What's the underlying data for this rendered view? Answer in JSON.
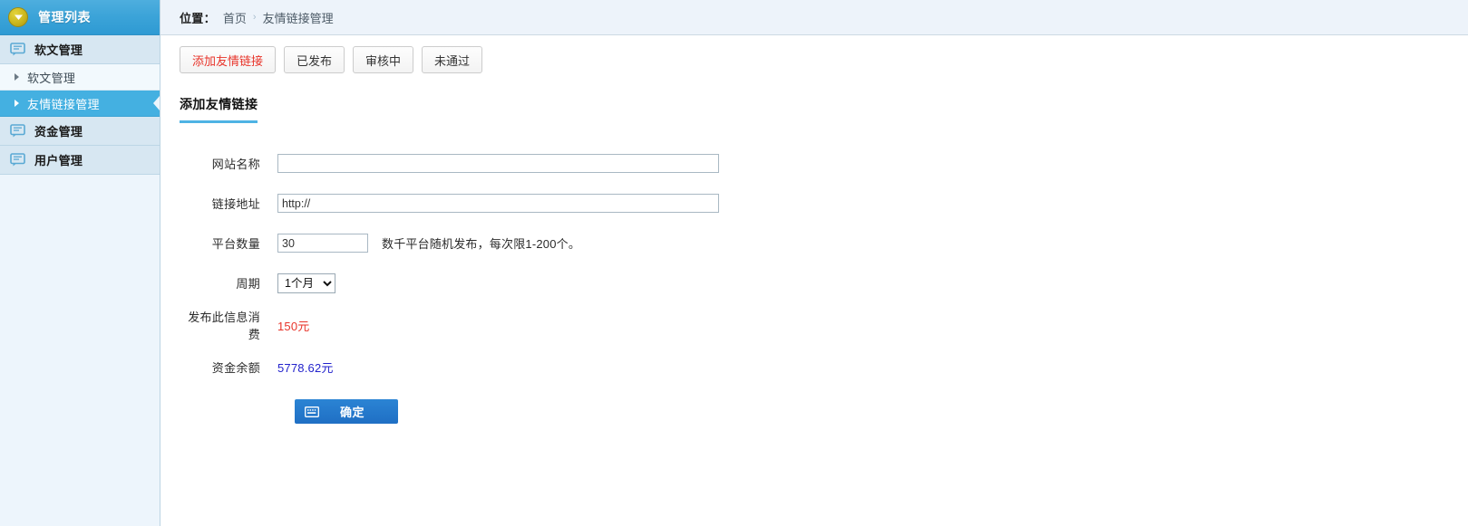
{
  "sidebar": {
    "header": {
      "title": "管理列表",
      "icon": "chevron-down-circle-icon"
    },
    "sections": [
      {
        "label": "软文管理",
        "icon": "speech-bubble-icon",
        "subitems": [
          {
            "label": "软文管理",
            "active": false
          },
          {
            "label": "友情链接管理",
            "active": true
          }
        ]
      },
      {
        "label": "资金管理",
        "icon": "speech-bubble-icon",
        "subitems": []
      },
      {
        "label": "用户管理",
        "icon": "speech-bubble-icon",
        "subitems": []
      }
    ]
  },
  "breadcrumb": {
    "label": "位置：",
    "home": "首页",
    "separator": "›",
    "current": "友情链接管理"
  },
  "tabs": [
    {
      "label": "添加友情链接",
      "active": true
    },
    {
      "label": "已发布",
      "active": false
    },
    {
      "label": "审核中",
      "active": false
    },
    {
      "label": "未通过",
      "active": false
    }
  ],
  "panel": {
    "title": "添加友情链接",
    "form": {
      "site_name": {
        "label": "网站名称",
        "value": "",
        "placeholder": ""
      },
      "link_url": {
        "label": "链接地址",
        "value": "http://"
      },
      "platform_count": {
        "label": "平台数量",
        "value": "30",
        "hint": "数千平台随机发布，每次限1-200个。"
      },
      "period": {
        "label": "周期",
        "value": "1个月",
        "options": [
          "1个月"
        ]
      },
      "cost": {
        "label": "发布此信息消费",
        "value": "150元"
      },
      "balance": {
        "label": "资金余额",
        "value": "5778.62元"
      },
      "submit": {
        "label": "确定",
        "icon": "keyboard-icon"
      }
    }
  },
  "colors": {
    "accent_blue": "#44b0e1",
    "header_blue": "#3ba3d8",
    "cost_red": "#e8342a",
    "balance_blue": "#2222cc",
    "button_blue": "#1f6fc4"
  }
}
